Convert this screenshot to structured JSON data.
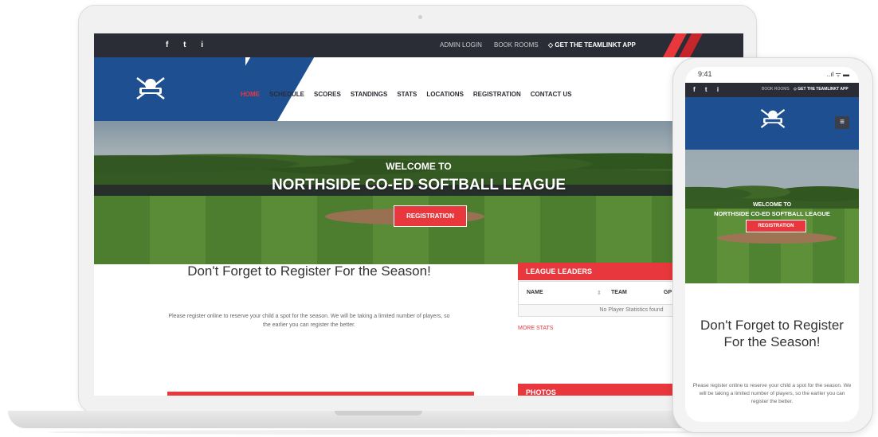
{
  "desktop": {
    "topbar": {
      "social": [
        "f",
        "t",
        "i"
      ],
      "admin_login": "ADMIN LOGIN",
      "book_rooms": "BOOK ROOMS",
      "app_icon": "◇",
      "app_label": "GET THE TEAMLINKT APP"
    },
    "nav": [
      "HOME",
      "SCHEDULE",
      "SCORES",
      "STANDINGS",
      "STATS",
      "LOCATIONS",
      "REGISTRATION",
      "CONTACT US"
    ],
    "hero": {
      "welcome": "WELCOME TO",
      "title": "NORTHSIDE CO-ED SOFTBALL LEAGUE",
      "button": "REGISTRATION"
    },
    "main": {
      "heading": "Don't Forget to Register For the Season!",
      "text": "Please register online to reserve your child a spot for the season. We will be taking a limited number of players, so the earlier you can register the better."
    },
    "league_leaders": {
      "title": "LEAGUE LEADERS",
      "columns": [
        "NAME",
        "TEAM",
        "GP"
      ],
      "empty": "No Player Statistics found",
      "more": "MORE STATS"
    },
    "photos": {
      "title": "PHOTOS"
    }
  },
  "mobile": {
    "status": {
      "time": "9:41",
      "signal": "..ıl ᯤ ▬"
    },
    "topbar": {
      "social": [
        "f",
        "t",
        "i"
      ],
      "book_rooms": "BOOK ROOMS",
      "app_label": "◇ GET THE TEAMLINKT APP"
    },
    "menu_icon": "≡",
    "hero": {
      "welcome": "WELCOME TO",
      "title": "NORTHSIDE CO-ED SOFTBALL LEAGUE",
      "button": "REGISTRATION"
    },
    "main": {
      "heading": "Don't Forget to Register For the Season!",
      "text": "Please register online to reserve your child a spot for the season. We will be taking a limited number of players, so the earlier you can register the better."
    }
  },
  "colors": {
    "accent": "#e8383d",
    "brand_blue": "#1d4f91",
    "topbar": "#2a2d35"
  }
}
